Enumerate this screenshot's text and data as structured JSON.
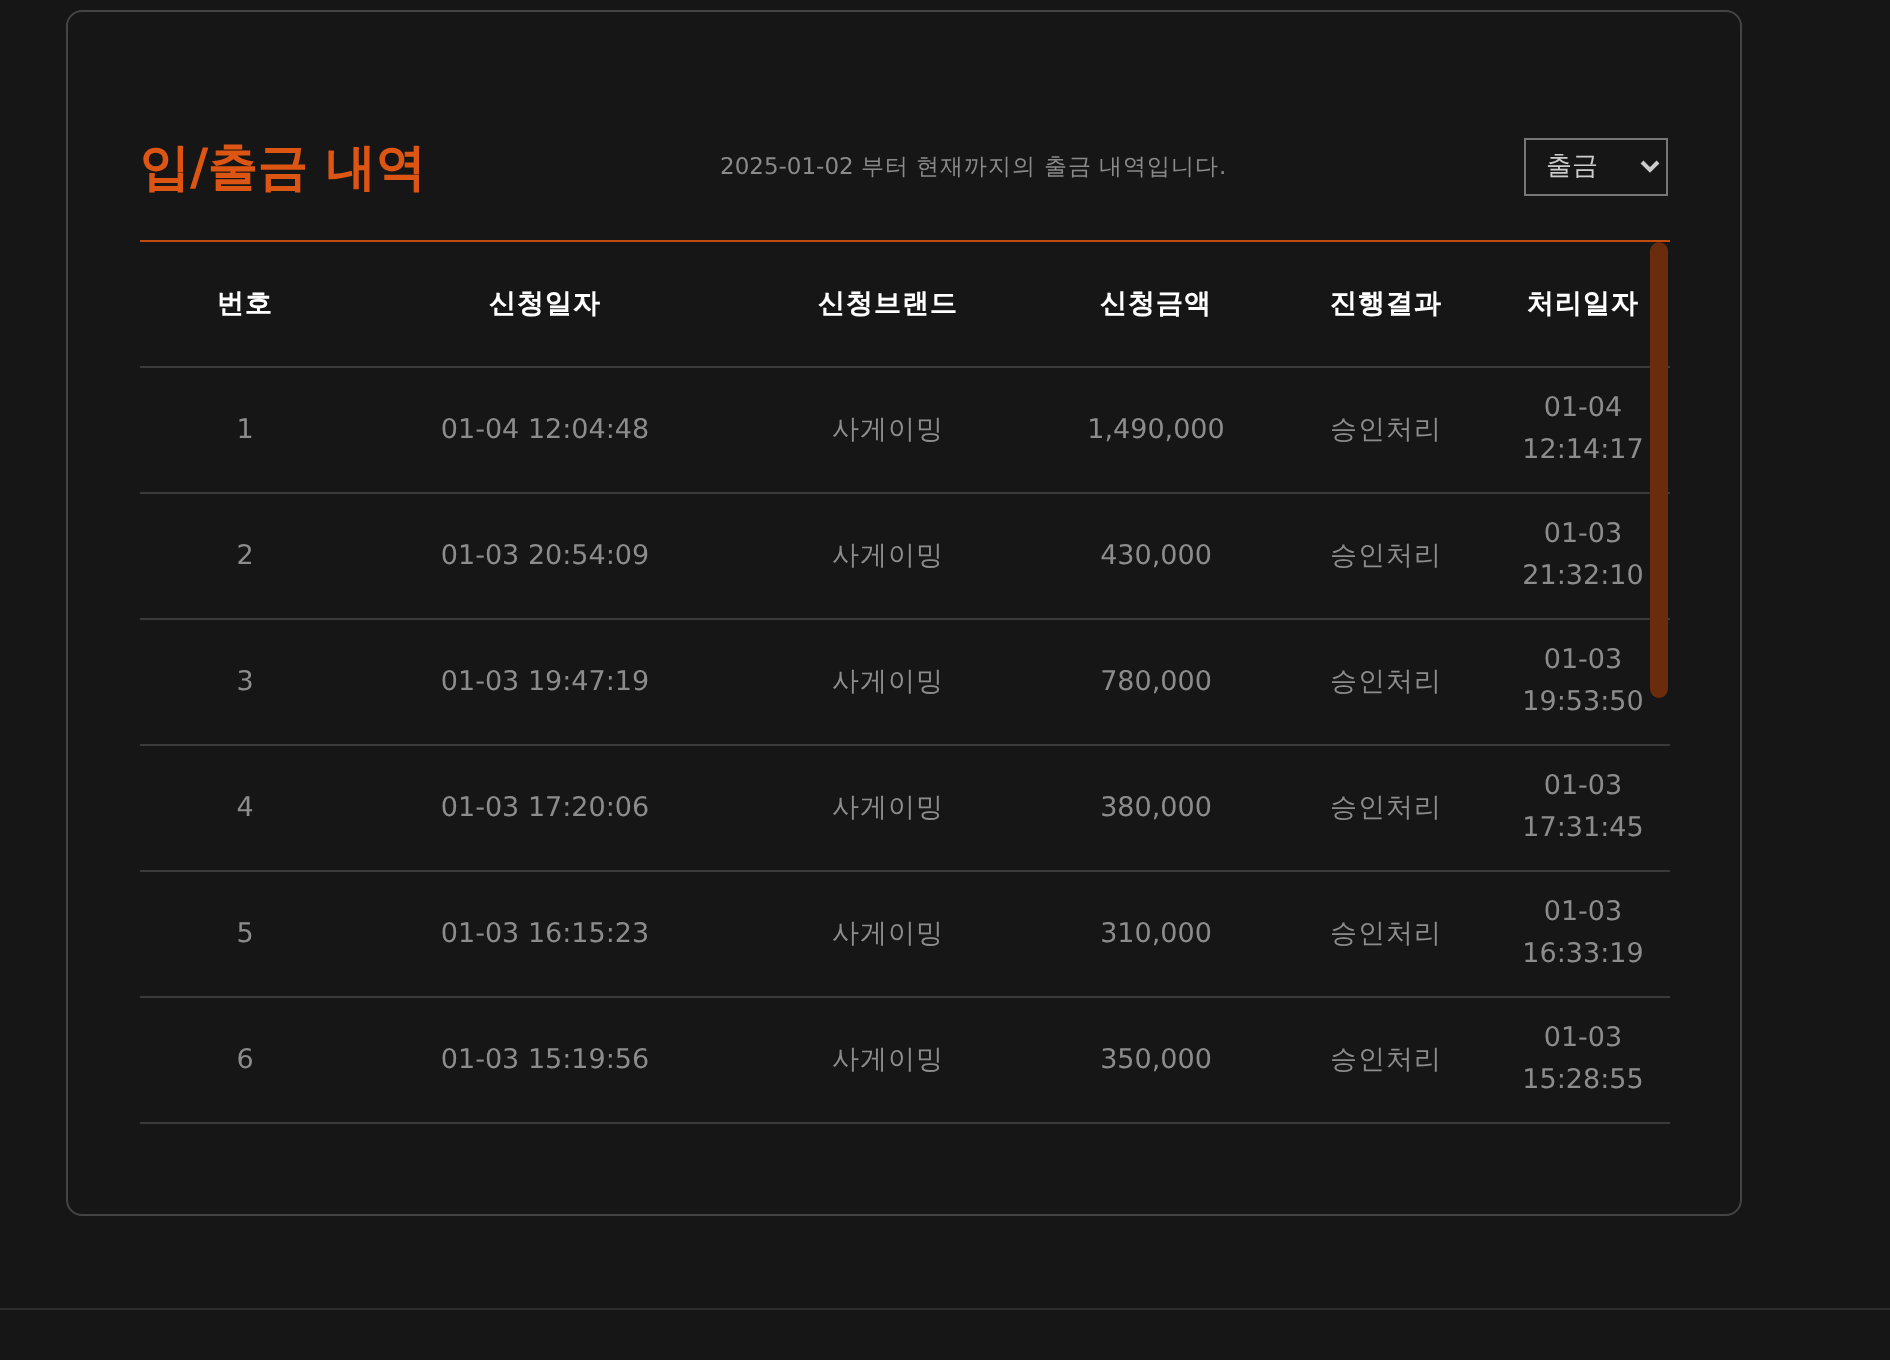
{
  "title": "입/출금 내역",
  "notice": "2025-01-02 부터 현재까지의 출금 내역입니다.",
  "filter": {
    "value": "출금"
  },
  "table": {
    "columns": [
      "번호",
      "신청일자",
      "신청브랜드",
      "신청금액",
      "진행결과",
      "처리일자"
    ],
    "rows": [
      [
        "1",
        "01-04 12:04:48",
        "사게이밍",
        "1,490,000",
        "승인처리",
        "01-04 12:14:17"
      ],
      [
        "2",
        "01-03 20:54:09",
        "사게이밍",
        "430,000",
        "승인처리",
        "01-03 21:32:10"
      ],
      [
        "3",
        "01-03 19:47:19",
        "사게이밍",
        "780,000",
        "승인처리",
        "01-03 19:53:50"
      ],
      [
        "4",
        "01-03 17:20:06",
        "사게이밍",
        "380,000",
        "승인처리",
        "01-03 17:31:45"
      ],
      [
        "5",
        "01-03 16:15:23",
        "사게이밍",
        "310,000",
        "승인처리",
        "01-03 16:33:19"
      ],
      [
        "6",
        "01-03 15:19:56",
        "사게이밍",
        "350,000",
        "승인처리",
        "01-03 15:28:55"
      ]
    ]
  }
}
